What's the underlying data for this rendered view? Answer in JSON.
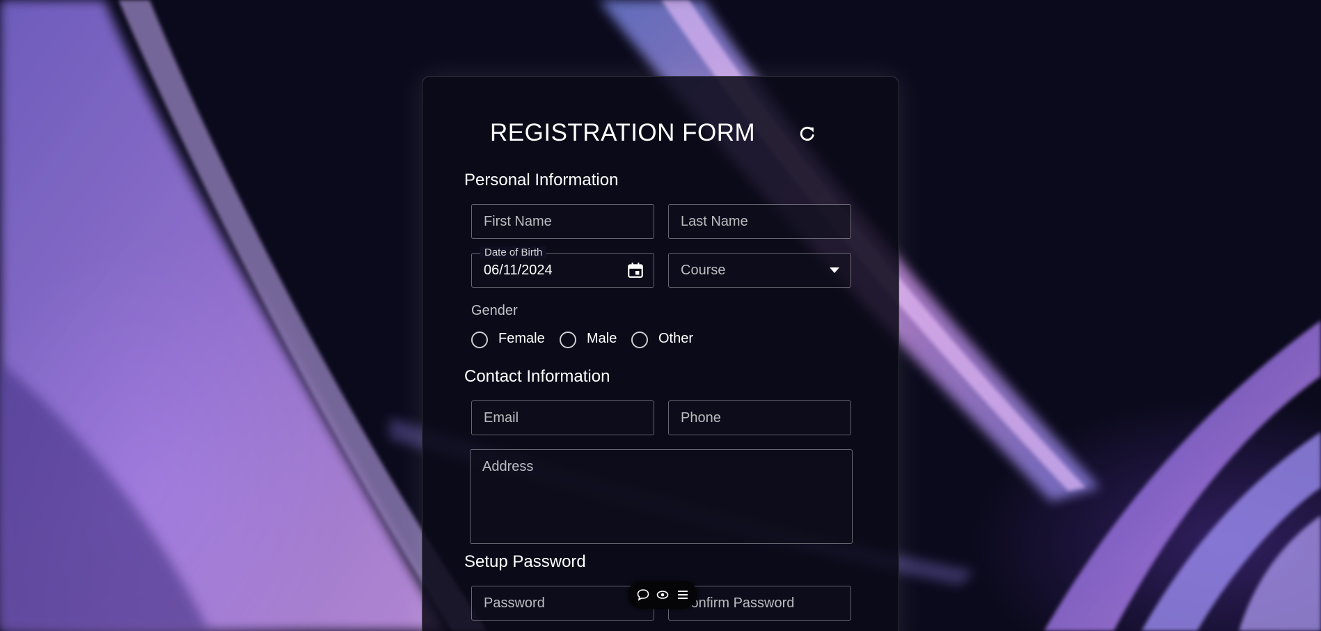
{
  "form": {
    "title": "REGISTRATION FORM",
    "refresh_icon": "refresh-icon"
  },
  "sections": {
    "personal": "Personal Information",
    "contact": "Contact Information",
    "password": "Setup Password"
  },
  "fields": {
    "first_name": {
      "placeholder": "First Name",
      "value": ""
    },
    "last_name": {
      "placeholder": "Last Name",
      "value": ""
    },
    "dob": {
      "label": "Date of Birth",
      "value": "06/11/2024",
      "icon": "calendar-icon"
    },
    "course": {
      "placeholder": "Course",
      "value": "",
      "icon": "caret-down-icon"
    },
    "email": {
      "placeholder": "Email",
      "value": ""
    },
    "phone": {
      "placeholder": "Phone",
      "value": ""
    },
    "address": {
      "placeholder": "Address",
      "value": ""
    },
    "password": {
      "placeholder": "Password",
      "value": ""
    },
    "confirm_password": {
      "placeholder": "Confirm Password",
      "value": ""
    }
  },
  "gender": {
    "label": "Gender",
    "options": [
      "Female",
      "Male",
      "Other"
    ],
    "selected": null
  },
  "floating_toolbar": {
    "icons": [
      "comment-icon",
      "eye-icon",
      "menu-icon"
    ]
  },
  "colors": {
    "background": "#0b0a1c",
    "accent_purple": "#9d78e6",
    "accent_pink": "#e2a2f5",
    "card_bg": "#0c0b18",
    "text": "#ffffff"
  }
}
